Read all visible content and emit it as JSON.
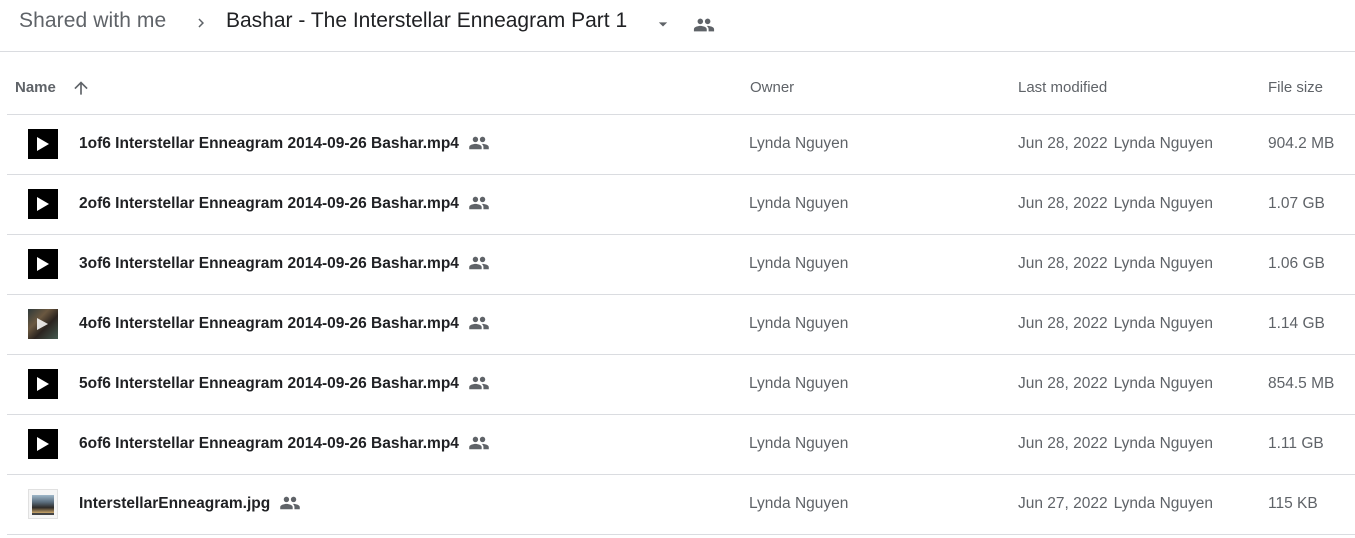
{
  "breadcrumb": {
    "root": "Shared with me",
    "separator_icon": "chevron-right-icon",
    "current": "Bashar - The Interstellar Enneagram Part 1",
    "dropdown_icon": "arrow-drop-down-icon",
    "shared_icon": "people-icon"
  },
  "columns": {
    "name": "Name",
    "sort_icon": "arrow-upward-icon",
    "owner": "Owner",
    "last_modified": "Last modified",
    "file_size": "File size"
  },
  "files": [
    {
      "name": "1of6 Interstellar Enneagram 2014-09-26 Bashar.mp4",
      "icon": "video-play-icon",
      "owner": "Lynda Nguyen",
      "modified_date": "Jun 28, 2022",
      "modified_by": "Lynda Nguyen",
      "size": "904.2 MB"
    },
    {
      "name": "2of6 Interstellar Enneagram 2014-09-26 Bashar.mp4",
      "icon": "video-play-icon",
      "owner": "Lynda Nguyen",
      "modified_date": "Jun 28, 2022",
      "modified_by": "Lynda Nguyen",
      "size": "1.07 GB"
    },
    {
      "name": "3of6 Interstellar Enneagram 2014-09-26 Bashar.mp4",
      "icon": "video-play-icon",
      "owner": "Lynda Nguyen",
      "modified_date": "Jun 28, 2022",
      "modified_by": "Lynda Nguyen",
      "size": "1.06 GB"
    },
    {
      "name": "4of6 Interstellar Enneagram 2014-09-26 Bashar.mp4",
      "icon": "video-thumbnail-icon",
      "owner": "Lynda Nguyen",
      "modified_date": "Jun 28, 2022",
      "modified_by": "Lynda Nguyen",
      "size": "1.14 GB"
    },
    {
      "name": "5of6 Interstellar Enneagram 2014-09-26 Bashar.mp4",
      "icon": "video-play-icon",
      "owner": "Lynda Nguyen",
      "modified_date": "Jun 28, 2022",
      "modified_by": "Lynda Nguyen",
      "size": "854.5 MB"
    },
    {
      "name": "6of6 Interstellar Enneagram 2014-09-26 Bashar.mp4",
      "icon": "video-play-icon",
      "owner": "Lynda Nguyen",
      "modified_date": "Jun 28, 2022",
      "modified_by": "Lynda Nguyen",
      "size": "1.11 GB"
    },
    {
      "name": "InterstellarEnneagram.jpg",
      "icon": "image-thumbnail-icon",
      "owner": "Lynda Nguyen",
      "modified_date": "Jun 27, 2022",
      "modified_by": "Lynda Nguyen",
      "size": "115 KB"
    }
  ],
  "colors": {
    "text_primary": "#202124",
    "text_secondary": "#5f6368",
    "divider": "#dadce0"
  }
}
